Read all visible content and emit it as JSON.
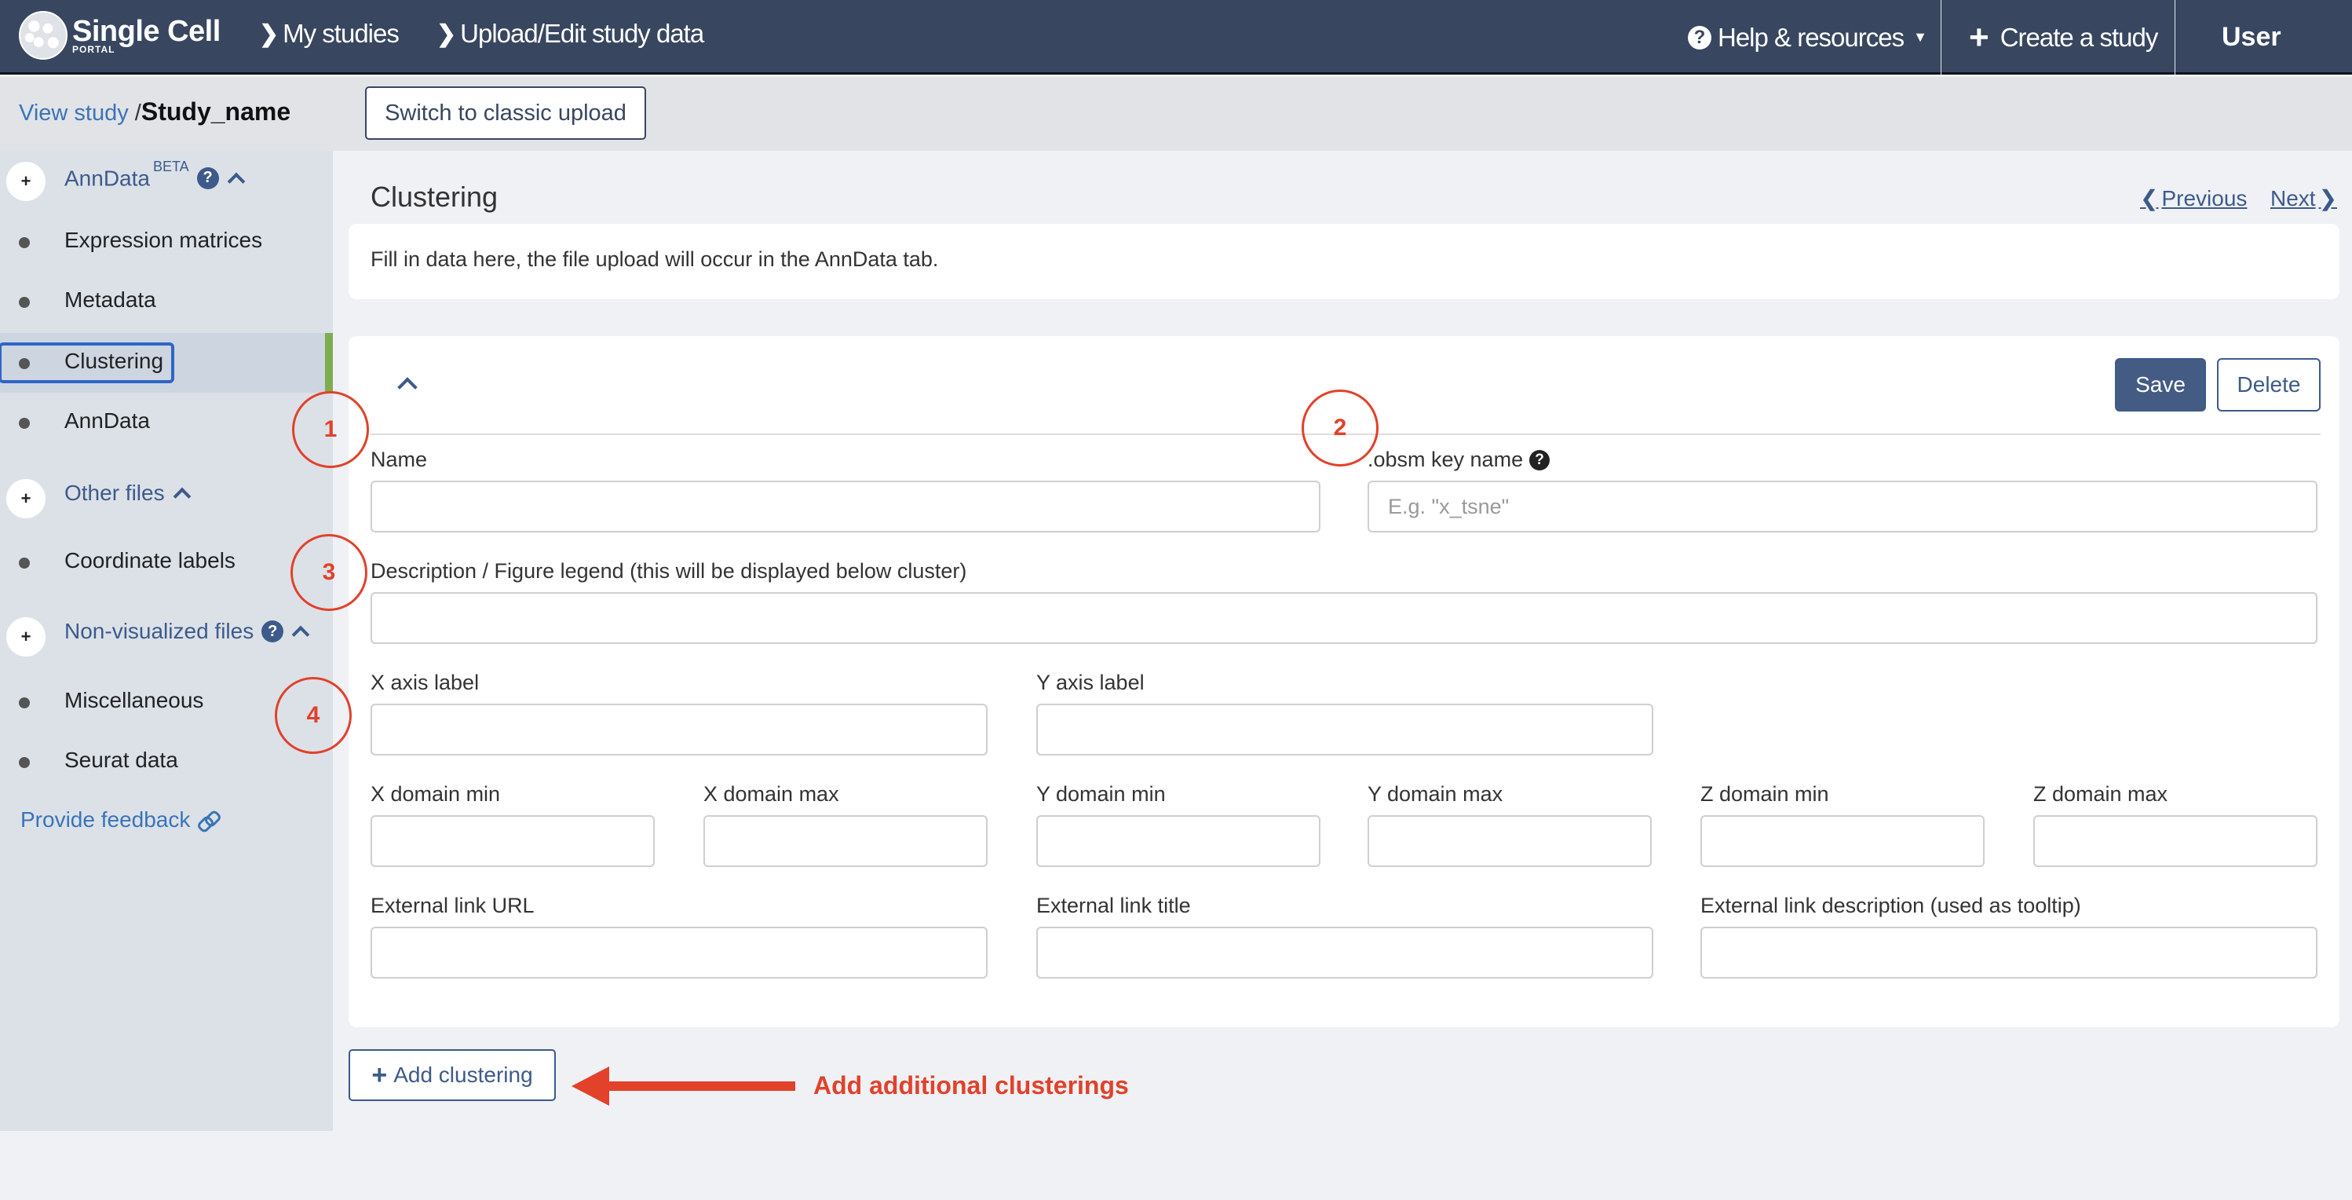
{
  "header": {
    "logo_title": "Single Cell",
    "logo_subtitle": "PORTAL",
    "nav": [
      {
        "label": "My studies",
        "icon": "chevron-right-icon"
      },
      {
        "label": "Upload/Edit study data",
        "icon": "chevron-right-icon"
      }
    ],
    "help_label": "Help & resources",
    "create_label": "Create a study",
    "user_label": "User"
  },
  "subheader": {
    "breadcrumb_link": "View study",
    "breadcrumb_sep": "/",
    "study_name": "Study_name",
    "classic_upload_label": "Switch to classic upload"
  },
  "sidebar": {
    "sections": [
      {
        "label": "AnnData",
        "badge": "BETA",
        "has_help": true,
        "expanded": true,
        "items": [
          {
            "label": "Expression matrices",
            "active": false
          },
          {
            "label": "Metadata",
            "active": false
          },
          {
            "label": "Clustering",
            "active": true
          },
          {
            "label": "AnnData",
            "active": false
          }
        ]
      },
      {
        "label": "Other files",
        "has_help": false,
        "expanded": true,
        "items": [
          {
            "label": "Coordinate labels",
            "active": false
          }
        ]
      },
      {
        "label": "Non-visualized files",
        "has_help": true,
        "expanded": true,
        "items": [
          {
            "label": "Miscellaneous",
            "active": false
          },
          {
            "label": "Seurat data",
            "active": false
          }
        ]
      }
    ],
    "feedback_label": "Provide feedback",
    "active_indicator_color": "#7ead4f"
  },
  "main": {
    "title": "Clustering",
    "previous_label": "Previous",
    "next_label": "Next",
    "info_text": "Fill in data here, the file upload will occur in the AnnData tab.",
    "form": {
      "save_label": "Save",
      "delete_label": "Delete",
      "fields": {
        "name": {
          "label": "Name",
          "value": "",
          "placeholder": ""
        },
        "obsm_key": {
          "label": ".obsm key name",
          "value": "",
          "placeholder": "E.g. \"x_tsne\""
        },
        "description": {
          "label": "Description / Figure legend (this will be displayed below cluster)",
          "value": ""
        },
        "x_axis_label": {
          "label": "X axis label",
          "value": ""
        },
        "y_axis_label": {
          "label": "Y axis label",
          "value": ""
        },
        "x_domain_min": {
          "label": "X domain min",
          "value": ""
        },
        "x_domain_max": {
          "label": "X domain max",
          "value": ""
        },
        "y_domain_min": {
          "label": "Y domain min",
          "value": ""
        },
        "y_domain_max": {
          "label": "Y domain max",
          "value": ""
        },
        "z_domain_min": {
          "label": "Z domain min",
          "value": ""
        },
        "z_domain_max": {
          "label": "Z domain max",
          "value": ""
        },
        "external_link_url": {
          "label": "External link URL",
          "value": ""
        },
        "external_link_title": {
          "label": "External link title",
          "value": ""
        },
        "external_link_description": {
          "label": "External link description (used as tooltip)",
          "value": ""
        }
      }
    },
    "add_clustering_label": "Add clustering"
  },
  "annotations": {
    "markers": [
      "1",
      "2",
      "3",
      "4"
    ],
    "arrow_text": "Add additional clusterings",
    "color": "#e2412a"
  }
}
